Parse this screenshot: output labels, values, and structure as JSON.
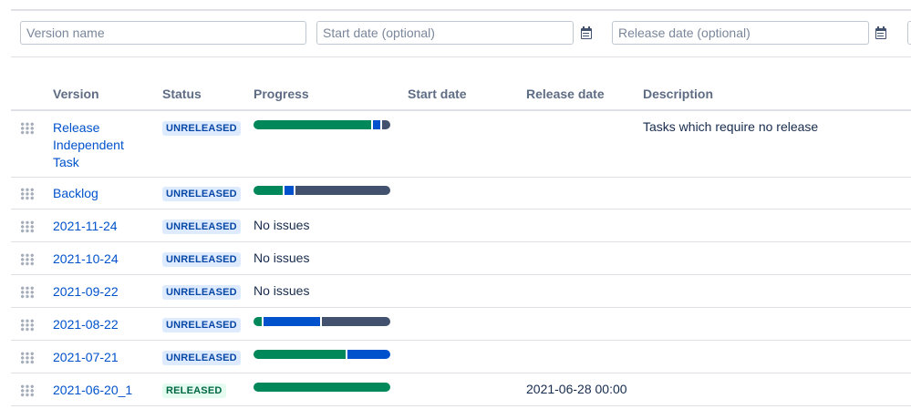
{
  "form": {
    "version_placeholder": "Version name",
    "start_placeholder": "Start date (optional)",
    "release_placeholder": "Release date (optional)"
  },
  "columns": {
    "version": "Version",
    "status": "Status",
    "progress": "Progress",
    "start_date": "Start date",
    "release_date": "Release date",
    "description": "Description"
  },
  "colors": {
    "done": "#00875a",
    "in_progress": "#0052cc",
    "todo": "#42526e"
  },
  "rows": [
    {
      "version": "Release Independent Task",
      "status": "UNRELEASED",
      "progress": {
        "done": 0.86,
        "in_progress": 0.05,
        "todo": 0.09
      },
      "no_issues": "",
      "release_date": "",
      "description": "Tasks which require no release"
    },
    {
      "version": "Backlog",
      "status": "UNRELEASED",
      "progress": {
        "done": 0.21,
        "in_progress": 0.07,
        "todo": 0.72
      },
      "no_issues": "",
      "release_date": "",
      "description": ""
    },
    {
      "version": "2021-11-24",
      "status": "UNRELEASED",
      "progress": null,
      "no_issues": "No issues",
      "release_date": "",
      "description": ""
    },
    {
      "version": "2021-10-24",
      "status": "UNRELEASED",
      "progress": null,
      "no_issues": "No issues",
      "release_date": "",
      "description": ""
    },
    {
      "version": "2021-09-22",
      "status": "UNRELEASED",
      "progress": null,
      "no_issues": "No issues",
      "release_date": "",
      "description": ""
    },
    {
      "version": "2021-08-22",
      "status": "UNRELEASED",
      "progress": {
        "done": 0.06,
        "in_progress": 0.41,
        "todo": 0.53
      },
      "no_issues": "",
      "release_date": "",
      "description": ""
    },
    {
      "version": "2021-07-21",
      "status": "UNRELEASED",
      "progress": {
        "done": 0.67,
        "in_progress": 0.33,
        "todo": 0
      },
      "no_issues": "",
      "release_date": "",
      "description": ""
    },
    {
      "version": "2021-06-20_1",
      "status": "RELEASED",
      "progress": {
        "done": 1,
        "in_progress": 0,
        "todo": 0
      },
      "no_issues": "",
      "release_date": "2021-06-28 00:00",
      "description": ""
    }
  ]
}
